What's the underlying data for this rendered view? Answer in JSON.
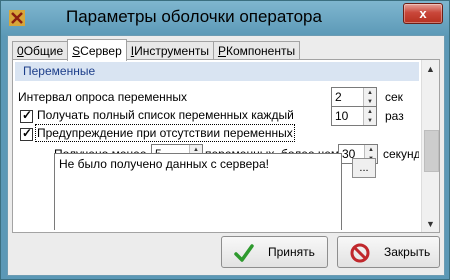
{
  "window": {
    "title": "Параметры оболочки оператора",
    "close_glyph": "x"
  },
  "tabs": [
    {
      "hotkey": "0",
      "label": " Общие"
    },
    {
      "hotkey": "S",
      "label": " Сервер"
    },
    {
      "hotkey": "I",
      "label": " Инструменты"
    },
    {
      "hotkey": "P",
      "label": " Компоненты"
    }
  ],
  "group": {
    "title": "Переменные"
  },
  "settings": {
    "poll_interval_label": "Интервал опроса переменных",
    "poll_interval_value": "2",
    "poll_interval_unit": "сек",
    "full_list_label": "Получать полный список переменных каждый",
    "full_list_checked": true,
    "full_list_value": "10",
    "full_list_unit": "раз",
    "warning_label": "Предупреждение при отсутствии переменных",
    "warning_checked": true,
    "received_less_label": "Получено менее",
    "received_less_value": "5",
    "more_than_label": "переменных, более чем",
    "more_than_value": "30",
    "more_than_unit": "секунд",
    "message_text": "Не было получено данных с сервера!",
    "dots_label": "..."
  },
  "buttons": {
    "ok_label": "Принять",
    "close_label": "Закрыть"
  },
  "colors": {
    "accent_header": "#d9e4f2",
    "ok_check": "#2e9a2e",
    "close_icon": "#c0282d"
  }
}
